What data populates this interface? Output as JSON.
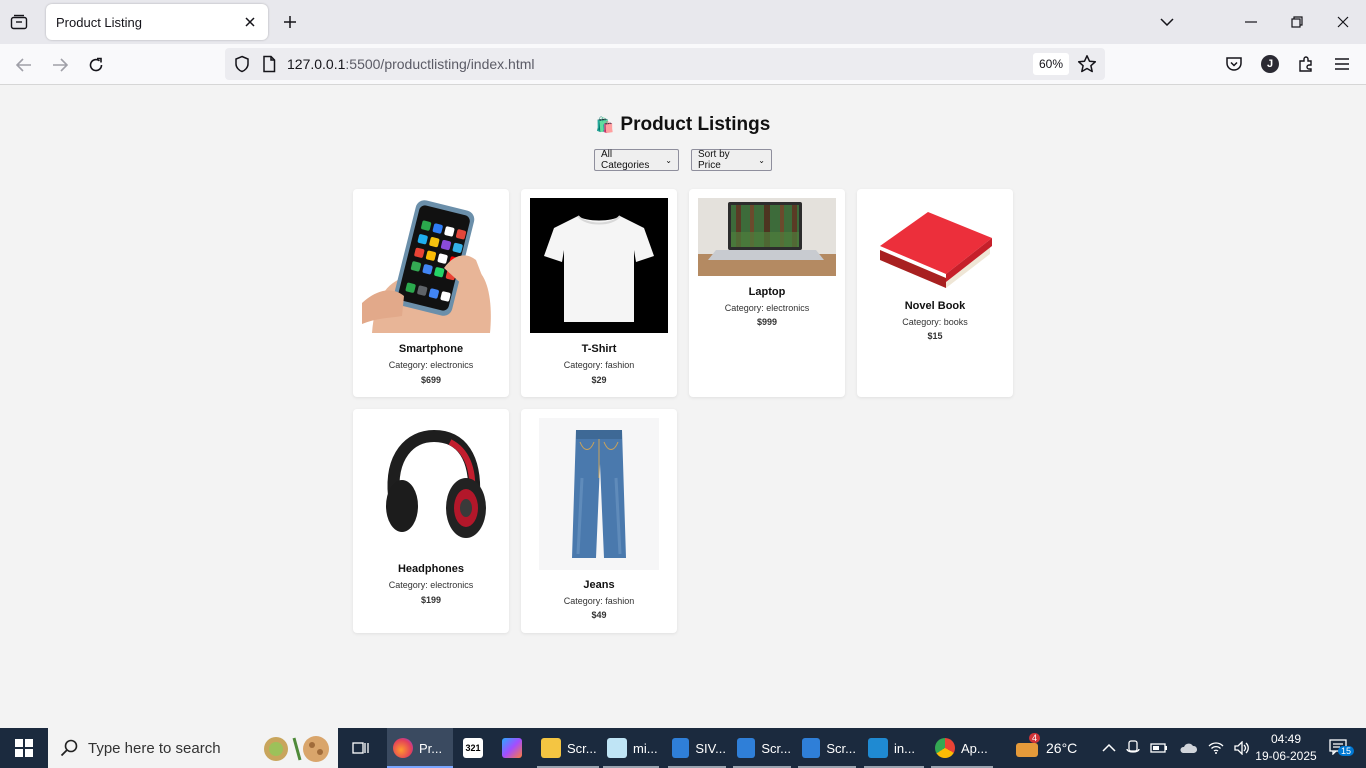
{
  "browser": {
    "tab_title": "Product Listing",
    "url_host": "127.0.0.1",
    "url_rest": ":5500/productlisting/index.html",
    "zoom": "60%",
    "profile_initial": "J"
  },
  "page": {
    "title_icon": "🛍️",
    "title": "Product Listings",
    "category_select": "All Categories",
    "sort_select": "Sort by Price"
  },
  "products": [
    {
      "name": "Smartphone",
      "category": "Category: electronics",
      "price": "$699",
      "image": "smartphone-image"
    },
    {
      "name": "T-Shirt",
      "category": "Category: fashion",
      "price": "$29",
      "image": "tshirt-image"
    },
    {
      "name": "Laptop",
      "category": "Category: electronics",
      "price": "$999",
      "image": "laptop-image"
    },
    {
      "name": "Novel Book",
      "category": "Category: books",
      "price": "$15",
      "image": "book-image"
    },
    {
      "name": "Headphones",
      "category": "Category: electronics",
      "price": "$199",
      "image": "headphones-image"
    },
    {
      "name": "Jeans",
      "category": "Category: fashion",
      "price": "$49",
      "image": "jeans-image"
    }
  ],
  "taskbar": {
    "search_placeholder": "Type here to search",
    "items": [
      {
        "label": "Pr...",
        "icon": "firefox-icon"
      },
      {
        "label": "Scr...",
        "icon": "file-explorer-icon"
      },
      {
        "label": "mi...",
        "icon": "notepad-icon"
      },
      {
        "label": "SIV...",
        "icon": "photos-icon"
      },
      {
        "label": "Scr...",
        "icon": "photos-icon"
      },
      {
        "label": "Scr...",
        "icon": "photos-icon"
      },
      {
        "label": "in...",
        "icon": "vscode-icon"
      },
      {
        "label": "Ap...",
        "icon": "chrome-icon"
      }
    ],
    "weather_temp": "26°C",
    "weather_badge": "4",
    "time": "04:49",
    "date": "19-06-2025",
    "notification_count": "15"
  }
}
